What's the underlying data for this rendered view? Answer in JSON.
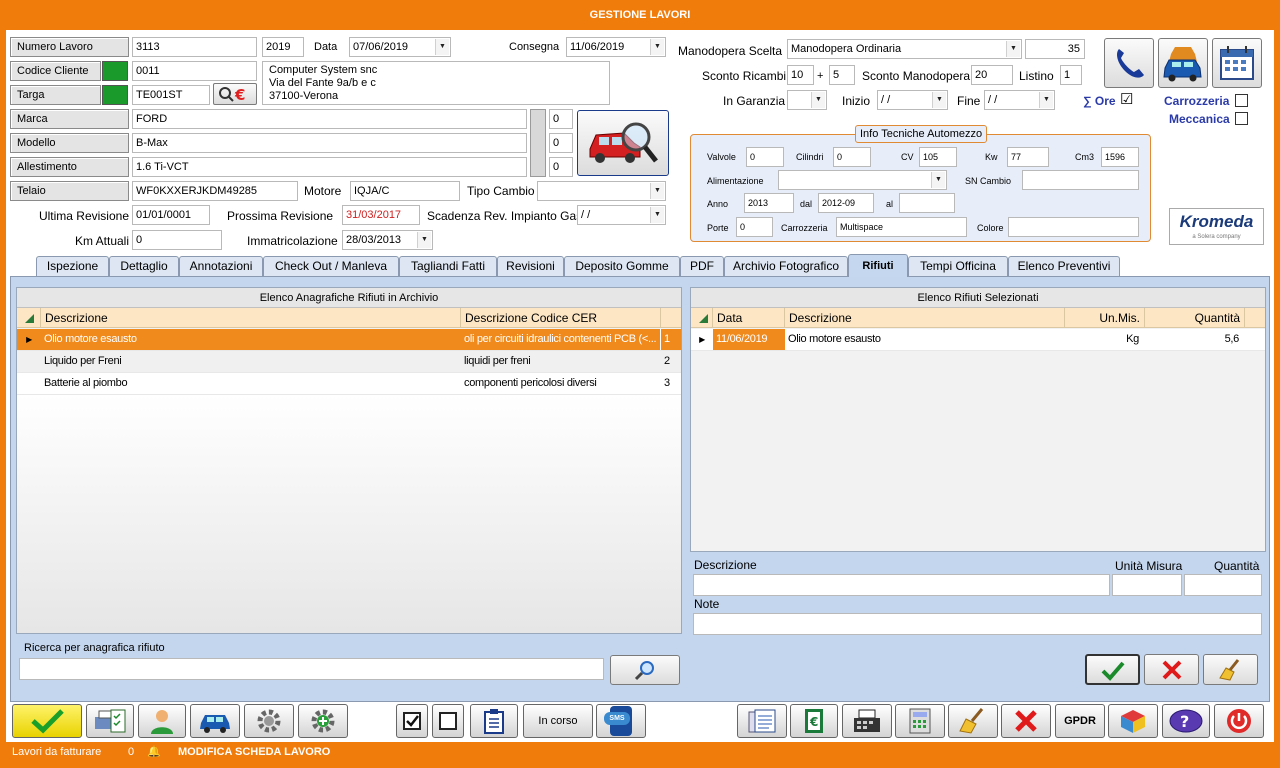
{
  "window": {
    "title": "GESTIONE LAVORI"
  },
  "header": {
    "numero_lavoro": {
      "label": "Numero Lavoro",
      "value": "3113",
      "year": "2019"
    },
    "data": {
      "label": "Data",
      "value": "07/06/2019"
    },
    "consegna": {
      "label": "Consegna",
      "value": "11/06/2019"
    },
    "codice_cliente": {
      "label": "Codice Cliente",
      "value": "0011"
    },
    "cliente_address": [
      "Computer System snc",
      "Via del Fante 9a/b e c",
      "37100-Verona"
    ],
    "targa": {
      "label": "Targa",
      "value": "TE001ST"
    },
    "marca": {
      "label": "Marca",
      "value": "FORD",
      "count": "0"
    },
    "modello": {
      "label": "Modello",
      "value": "B-Max",
      "count": "0"
    },
    "allestimento": {
      "label": "Allestimento",
      "value": "1.6 Ti-VCT",
      "count": "0"
    },
    "telaio": {
      "label": "Telaio",
      "value": "WF0KXXERJKDM49285"
    },
    "motore": {
      "label": "Motore",
      "value": "IQJA/C"
    },
    "tipo_cambio": {
      "label": "Tipo Cambio",
      "value": ""
    },
    "ultima_revisione": {
      "label": "Ultima Revisione",
      "value": "01/01/0001"
    },
    "prossima_revisione": {
      "label": "Prossima Revisione",
      "value": "31/03/2017"
    },
    "scadenza_gas": {
      "label": "Scadenza Rev. Impianto Gas",
      "value": " /  /"
    },
    "km_attuali": {
      "label": "Km Attuali",
      "value": "0"
    },
    "immatricolazione": {
      "label": "Immatricolazione",
      "value": "28/03/2013"
    }
  },
  "manodopera": {
    "scelta_label": "Manodopera Scelta",
    "scelta_value": "Manodopera Ordinaria",
    "rate": "35",
    "sconto_ricambi_label": "Sconto Ricambi",
    "sconto_ricambi_1": "10",
    "plus": "+",
    "sconto_ricambi_2": "5",
    "sconto_manodopera_label": "Sconto Manodopera",
    "sconto_manodopera": "20",
    "listino_label": "Listino",
    "listino": "1",
    "garanzia_label": "In Garanzia",
    "garanzia": "",
    "inizio_label": "Inizio",
    "inizio": " /  /",
    "fine_label": "Fine",
    "fine": " /  /",
    "ore_label": "∑ Ore",
    "ore_check": "☑",
    "carrozzeria_label": "Carrozzeria",
    "meccanica_label": "Meccanica"
  },
  "info_tecniche": {
    "title": "Info Tecniche Automezzo",
    "valvole_label": "Valvole",
    "valvole": "0",
    "cilindri_label": "Cilindri",
    "cilindri": "0",
    "cv_label": "CV",
    "cv": "105",
    "kw_label": "Kw",
    "kw": "77",
    "cm3_label": "Cm3",
    "cm3": "1596",
    "alimentazione_label": "Alimentazione",
    "alimentazione": "",
    "sn_cambio_label": "SN Cambio",
    "sn_cambio": "",
    "anno_label": "Anno",
    "anno": "2013",
    "dal_label": "dal",
    "dal": "2012-09",
    "al_label": "al",
    "al": "",
    "porte_label": "Porte",
    "porte": "0",
    "carrozzeria_label": "Carrozzeria",
    "carrozzeria": "Multispace",
    "colore_label": "Colore",
    "colore": ""
  },
  "logo": {
    "name": "Kromeda",
    "sub": "a Solera company"
  },
  "tabs": [
    "Ispezione",
    "Dettaglio",
    "Annotazioni",
    "Check Out / Manleva",
    "Tagliandi Fatti",
    "Revisioni",
    "Deposito Gomme",
    "PDF",
    "Archivio Fotografico",
    "Rifiuti",
    "Tempi Officina",
    "Elenco Preventivi"
  ],
  "active_tab": "Rifiuti",
  "archivio": {
    "title": "Elenco Anagrafiche Rifiuti in Archivio",
    "columns": [
      "Descrizione",
      "Descrizione Codice CER"
    ],
    "rows": [
      {
        "descrizione": "Olio motore esausto",
        "cer": "oli per circuiti idraulici contenenti PCB (<...",
        "id": "1"
      },
      {
        "descrizione": "Liquido per Freni",
        "cer": "liquidi per freni",
        "id": "2"
      },
      {
        "descrizione": "Batterie al piombo",
        "cer": "componenti pericolosi diversi",
        "id": "3"
      }
    ]
  },
  "selezionati": {
    "title": "Elenco Rifiuti Selezionati",
    "columns": [
      "Data",
      "Descrizione",
      "Un.Mis.",
      "Quantità"
    ],
    "rows": [
      {
        "data": "11/06/2019",
        "descrizione": "Olio motore esausto",
        "unmis": "Kg",
        "quantita": "5,6"
      }
    ]
  },
  "editor": {
    "descrizione_label": "Descrizione",
    "unita_label": "Unità Misura",
    "quantita_label": "Quantità",
    "note_label": "Note",
    "descrizione": "",
    "unita": "",
    "quantita": "",
    "note": ""
  },
  "ricerca": {
    "label": "Ricerca per anagrafica rifiuto",
    "value": ""
  },
  "toolbar": {
    "in_corso": "In corso",
    "sms": "SMS",
    "gpdr": "GPDR"
  },
  "status": {
    "label": "Lavori da fatturare",
    "count": "0",
    "mode": "MODIFICA SCHEDA LAVORO"
  },
  "colors": {
    "accent": "#f07c0c",
    "panel": "#c4d6ee",
    "selection": "#f08a1c"
  }
}
